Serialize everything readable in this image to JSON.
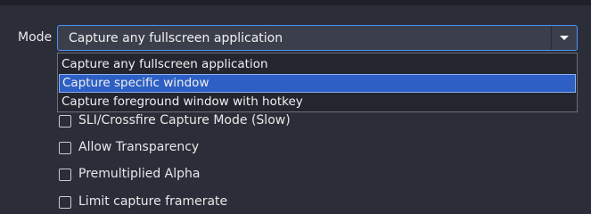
{
  "mode": {
    "label": "Mode",
    "selected": "Capture any fullscreen application",
    "options": [
      "Capture any fullscreen application",
      "Capture specific window",
      "Capture foreground window with hotkey"
    ],
    "highlighted_index": 1
  },
  "checkboxes": [
    {
      "label": "SLI/Crossfire Capture Mode (Slow)",
      "checked": false
    },
    {
      "label": "Allow Transparency",
      "checked": false
    },
    {
      "label": "Premultiplied Alpha",
      "checked": false
    },
    {
      "label": "Limit capture framerate",
      "checked": false
    }
  ],
  "colors": {
    "background": "#2b2e38",
    "combo_border": "#4d90fe",
    "highlight": "#2d5fc4"
  }
}
